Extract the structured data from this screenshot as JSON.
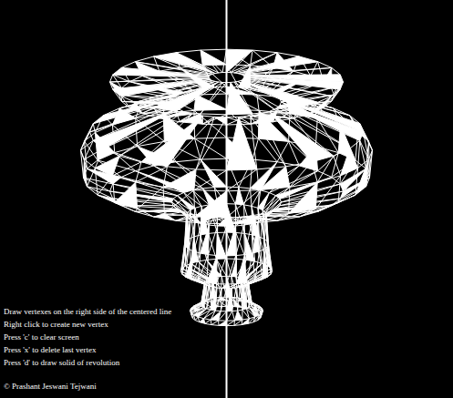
{
  "canvas": {
    "instructions": [
      "Draw vertexes on the right side of the centered line",
      "Right click to create new vertex",
      "Press 'c' to clear screen",
      "Press 'x' to delete last vertex",
      "Press 'd' to draw solid of revolution"
    ],
    "copyright": "© Prashant Jeswani Tejwani"
  }
}
